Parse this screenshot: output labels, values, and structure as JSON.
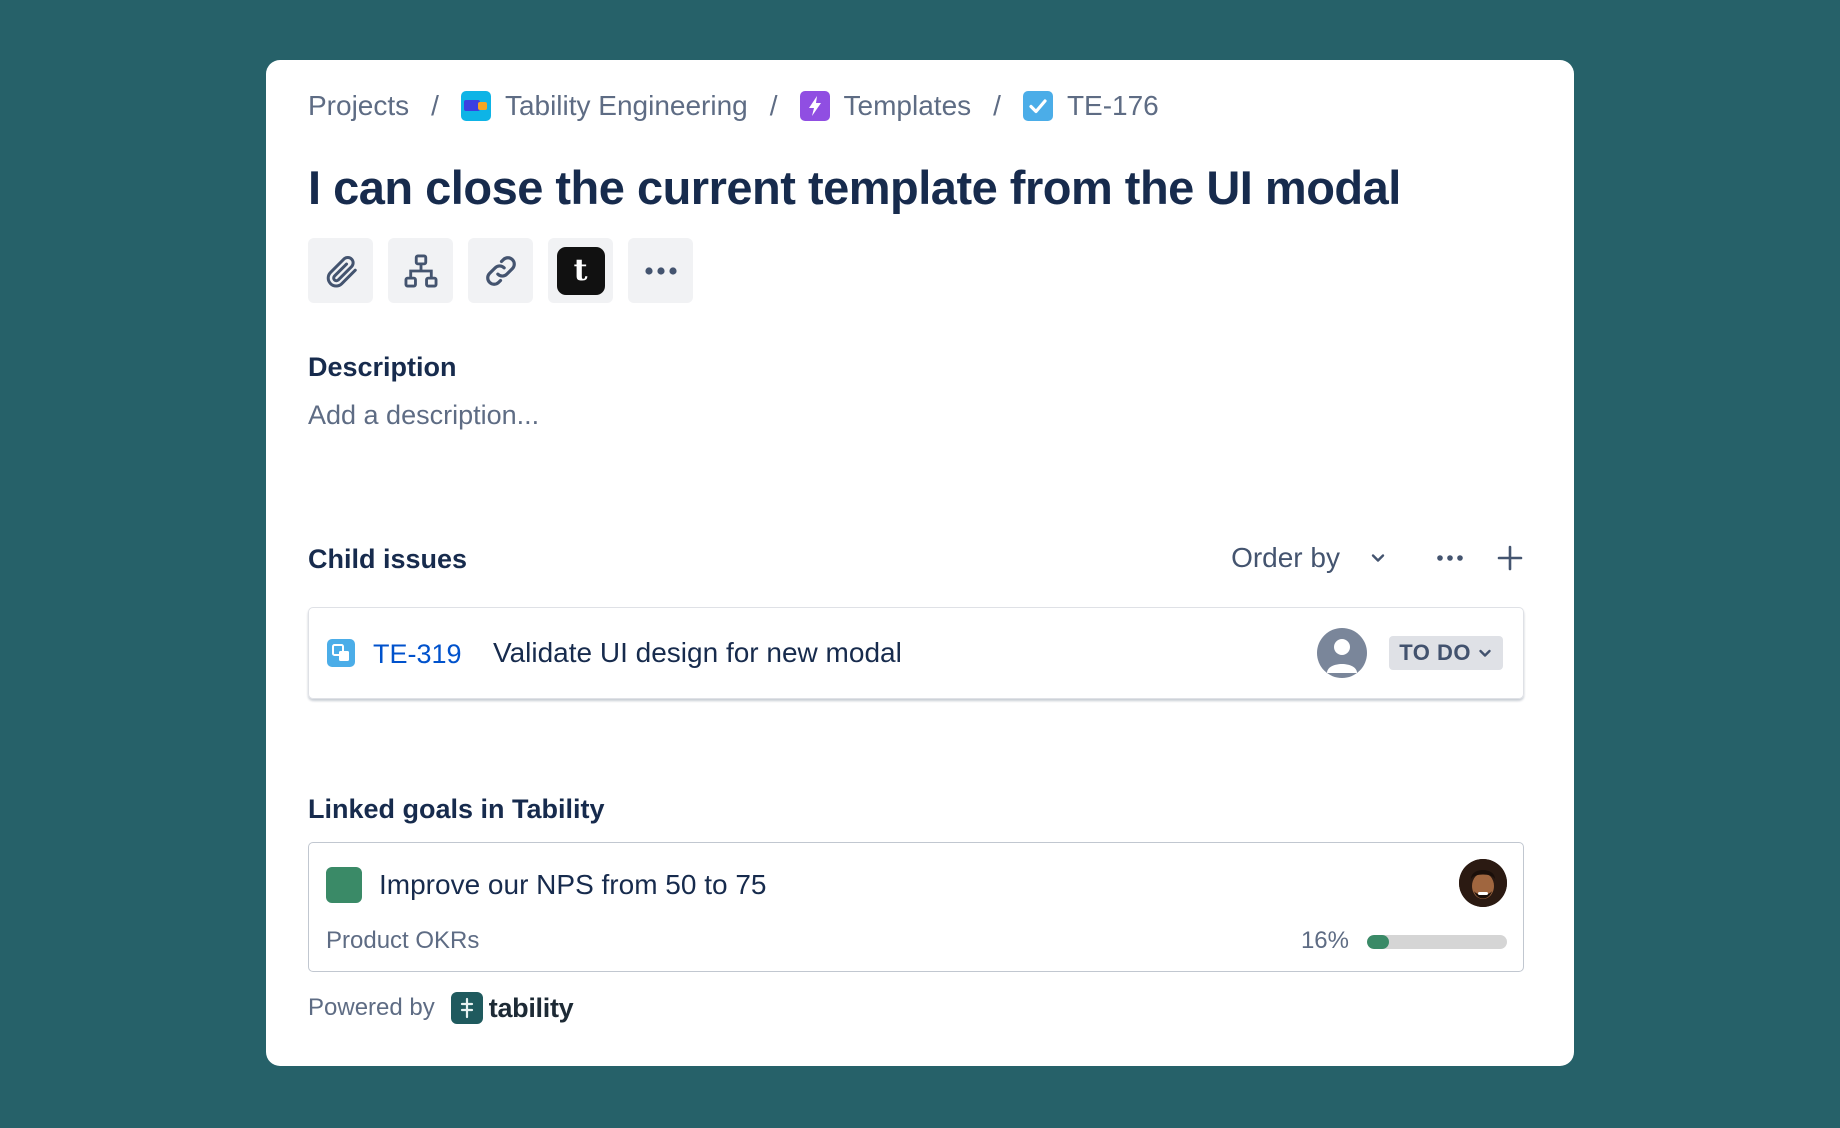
{
  "breadcrumb": {
    "items": [
      {
        "label": "Projects",
        "icon": null
      },
      {
        "label": "Tability Engineering",
        "icon": "project-icon"
      },
      {
        "label": "Templates",
        "icon": "epic-lightning-icon"
      },
      {
        "label": "TE-176",
        "icon": "task-checkbox-icon"
      }
    ],
    "separator": "/"
  },
  "issue": {
    "title": "I can close the current template from the UI modal"
  },
  "toolbar": {
    "buttons": [
      "paperclip-icon",
      "hierarchy-icon",
      "link-icon",
      "tability-app-icon",
      "more-icon"
    ],
    "tability_glyph": "t"
  },
  "description": {
    "heading": "Description",
    "placeholder": "Add a description..."
  },
  "child_issues": {
    "heading": "Child issues",
    "order_by_label": "Order by",
    "items": [
      {
        "key": "TE-319",
        "summary": "Validate UI design for new modal",
        "status": "TO DO",
        "assignee": "unassigned"
      }
    ]
  },
  "linked_goals": {
    "heading": "Linked goals in Tability",
    "items": [
      {
        "title": "Improve our NPS from 50 to 75",
        "plan": "Product OKRs",
        "progress_text": "16%",
        "progress": 0.16
      }
    ]
  },
  "footer": {
    "powered_by": "Powered by",
    "brand": "tability"
  },
  "colors": {
    "background": "#266169",
    "card": "#ffffff",
    "text": "#172b4d",
    "link": "#0052cc",
    "goal_green": "#3a8a67"
  }
}
